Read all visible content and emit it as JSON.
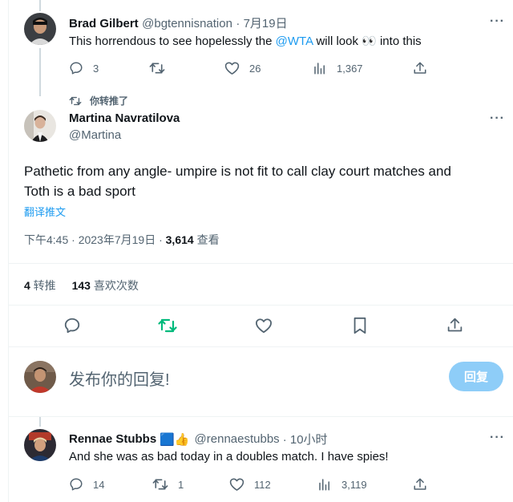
{
  "tweet1": {
    "name": "Brad Gilbert",
    "handle": "@bgtennisnation",
    "time": "· 7月19日",
    "text_before": "This horrendous to see hopelessly the ",
    "mention": "@WTA",
    "text_after": " will look 👀 into this",
    "replies": "3",
    "retweets": "",
    "likes": "26",
    "views": "1,367"
  },
  "retweet_banner": "你转推了",
  "main": {
    "name": "Martina Navratilova",
    "handle": "@Martina",
    "text_line1": "Pathetic from any angle- umpire is not fit to call clay court matches and",
    "text_line2": "Toth is a bad sport",
    "translate": "翻译推文",
    "meta_time": "下午4:45 · 2023年7月19日 · ",
    "views_count": "3,614",
    "views_label": " 查看",
    "retweet_count": "4",
    "retweet_label": " 转推",
    "like_count": "143",
    "like_label": " 喜欢次数"
  },
  "compose": {
    "placeholder": "发布你的回复!",
    "button": "回复"
  },
  "tweet3": {
    "name": "Rennae Stubbs",
    "emoji": "🟦👍",
    "handle": "@rennaestubbs",
    "time": "· 10小时",
    "text": "And she was as bad today in a doubles match. I have spies!",
    "replies": "14",
    "retweets": "1",
    "likes": "112",
    "views": "3,119"
  },
  "colors": {
    "accent": "#1d9bf0",
    "retweet_green": "#00ba7c",
    "muted": "#536471",
    "button_disabled": "#8ecdf8"
  },
  "icons": [
    "reply-icon",
    "retweet-icon",
    "like-icon",
    "views-icon",
    "share-icon",
    "bookmark-icon",
    "more-icon",
    "verified-icon"
  ]
}
